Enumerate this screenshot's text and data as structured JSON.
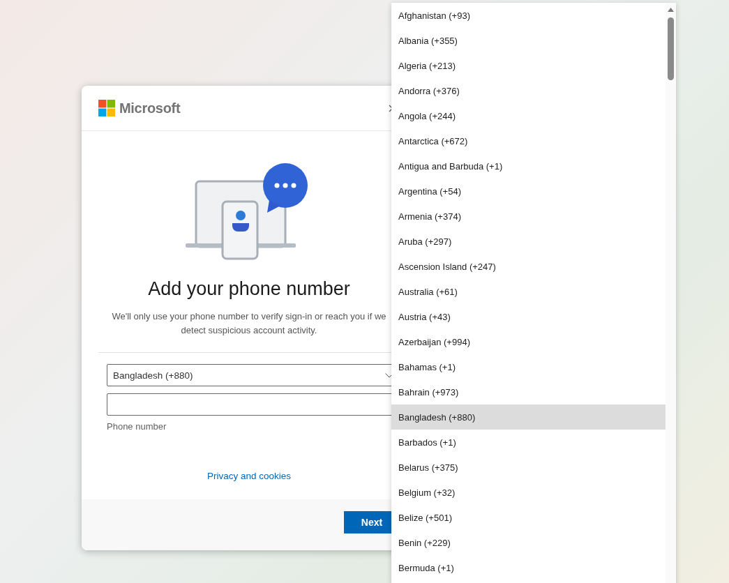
{
  "dialog": {
    "brand": "Microsoft",
    "title": "Add your phone number",
    "description": "We'll only use your phone number to verify sign-in or reach you if we detect suspicious account activity.",
    "country_select": {
      "value": "Bangladesh (+880)"
    },
    "phone_field": {
      "label": "Phone number"
    },
    "privacy_link": "Privacy and cookies",
    "next_button": "Next"
  },
  "country_list": {
    "items": [
      {
        "label": "Afghanistan (+93)",
        "selected": false
      },
      {
        "label": "Albania (+355)",
        "selected": false
      },
      {
        "label": "Algeria (+213)",
        "selected": false
      },
      {
        "label": "Andorra (+376)",
        "selected": false
      },
      {
        "label": "Angola (+244)",
        "selected": false
      },
      {
        "label": "Antarctica (+672)",
        "selected": false
      },
      {
        "label": "Antigua and Barbuda (+1)",
        "selected": false
      },
      {
        "label": "Argentina (+54)",
        "selected": false
      },
      {
        "label": "Armenia (+374)",
        "selected": false
      },
      {
        "label": "Aruba (+297)",
        "selected": false
      },
      {
        "label": "Ascension Island (+247)",
        "selected": false
      },
      {
        "label": "Australia (+61)",
        "selected": false
      },
      {
        "label": "Austria (+43)",
        "selected": false
      },
      {
        "label": "Azerbaijan (+994)",
        "selected": false
      },
      {
        "label": "Bahamas (+1)",
        "selected": false
      },
      {
        "label": "Bahrain (+973)",
        "selected": false
      },
      {
        "label": "Bangladesh (+880)",
        "selected": true
      },
      {
        "label": "Barbados (+1)",
        "selected": false
      },
      {
        "label": "Belarus (+375)",
        "selected": false
      },
      {
        "label": "Belgium (+32)",
        "selected": false
      },
      {
        "label": "Belize (+501)",
        "selected": false
      },
      {
        "label": "Benin (+229)",
        "selected": false
      },
      {
        "label": "Bermuda (+1)",
        "selected": false
      }
    ]
  }
}
